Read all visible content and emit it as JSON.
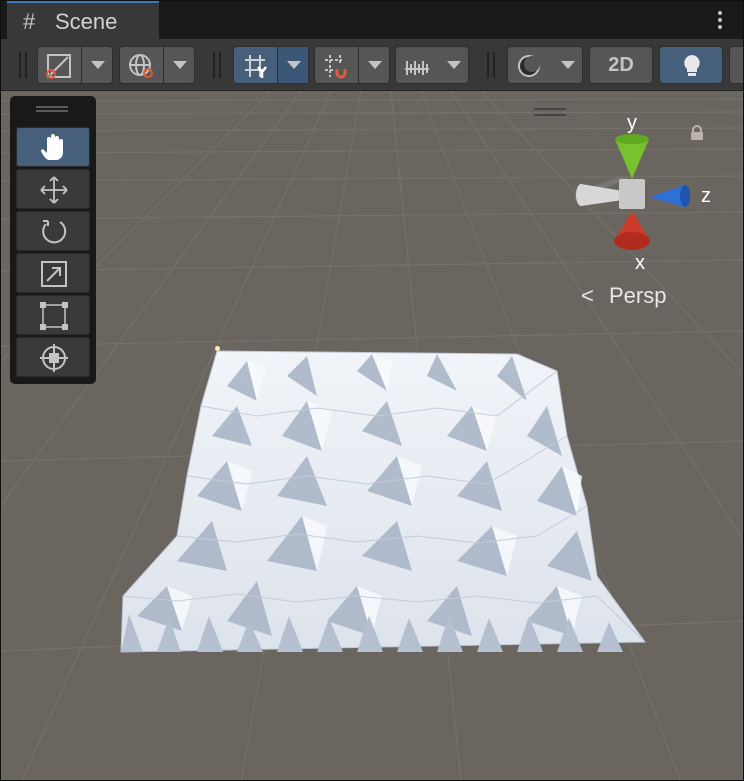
{
  "window": {
    "tab": {
      "icon": "grid-hash-icon",
      "glyph": "#",
      "label": "Scene"
    },
    "menu_icon": "more-vertical-icon"
  },
  "toolbar": {
    "draw_mode": {
      "icon": "draw-mode-icon"
    },
    "scene_view_options": {
      "icon": "globe-overlay-icon"
    },
    "grid_toggle": {
      "icon": "grid-y-icon",
      "active": true
    },
    "snap_toggle": {
      "icon": "grid-snap-magnet-icon"
    },
    "increment_snap": {
      "icon": "ruler-icon"
    },
    "shading_mode": {
      "icon": "shading-sphere-icon"
    },
    "view_2d": {
      "label": "2D"
    },
    "lighting": {
      "icon": "lightbulb-icon",
      "active": true
    }
  },
  "tools": [
    {
      "name": "hand",
      "icon": "hand-icon",
      "active": true
    },
    {
      "name": "move",
      "icon": "move-arrows-icon",
      "active": false
    },
    {
      "name": "rotate",
      "icon": "rotate-icon",
      "active": false
    },
    {
      "name": "scale",
      "icon": "scale-icon",
      "active": false
    },
    {
      "name": "rect",
      "icon": "rect-transform-icon",
      "active": false
    },
    {
      "name": "transform",
      "icon": "transform-icon",
      "active": false
    }
  ],
  "gizmo": {
    "axis_y": "y",
    "axis_x": "x",
    "axis_z": "z",
    "colors": {
      "y": "#77c22e",
      "x": "#cc3a2a",
      "z": "#2f6fd8",
      "neg": "#d7d7d7"
    }
  },
  "projection": {
    "label": "Persp",
    "glyph": "<"
  },
  "colors": {
    "viewport": "#6a655f",
    "toolbar": "#383838",
    "accent": "#46607c",
    "terrain": "#e6ebf2"
  }
}
